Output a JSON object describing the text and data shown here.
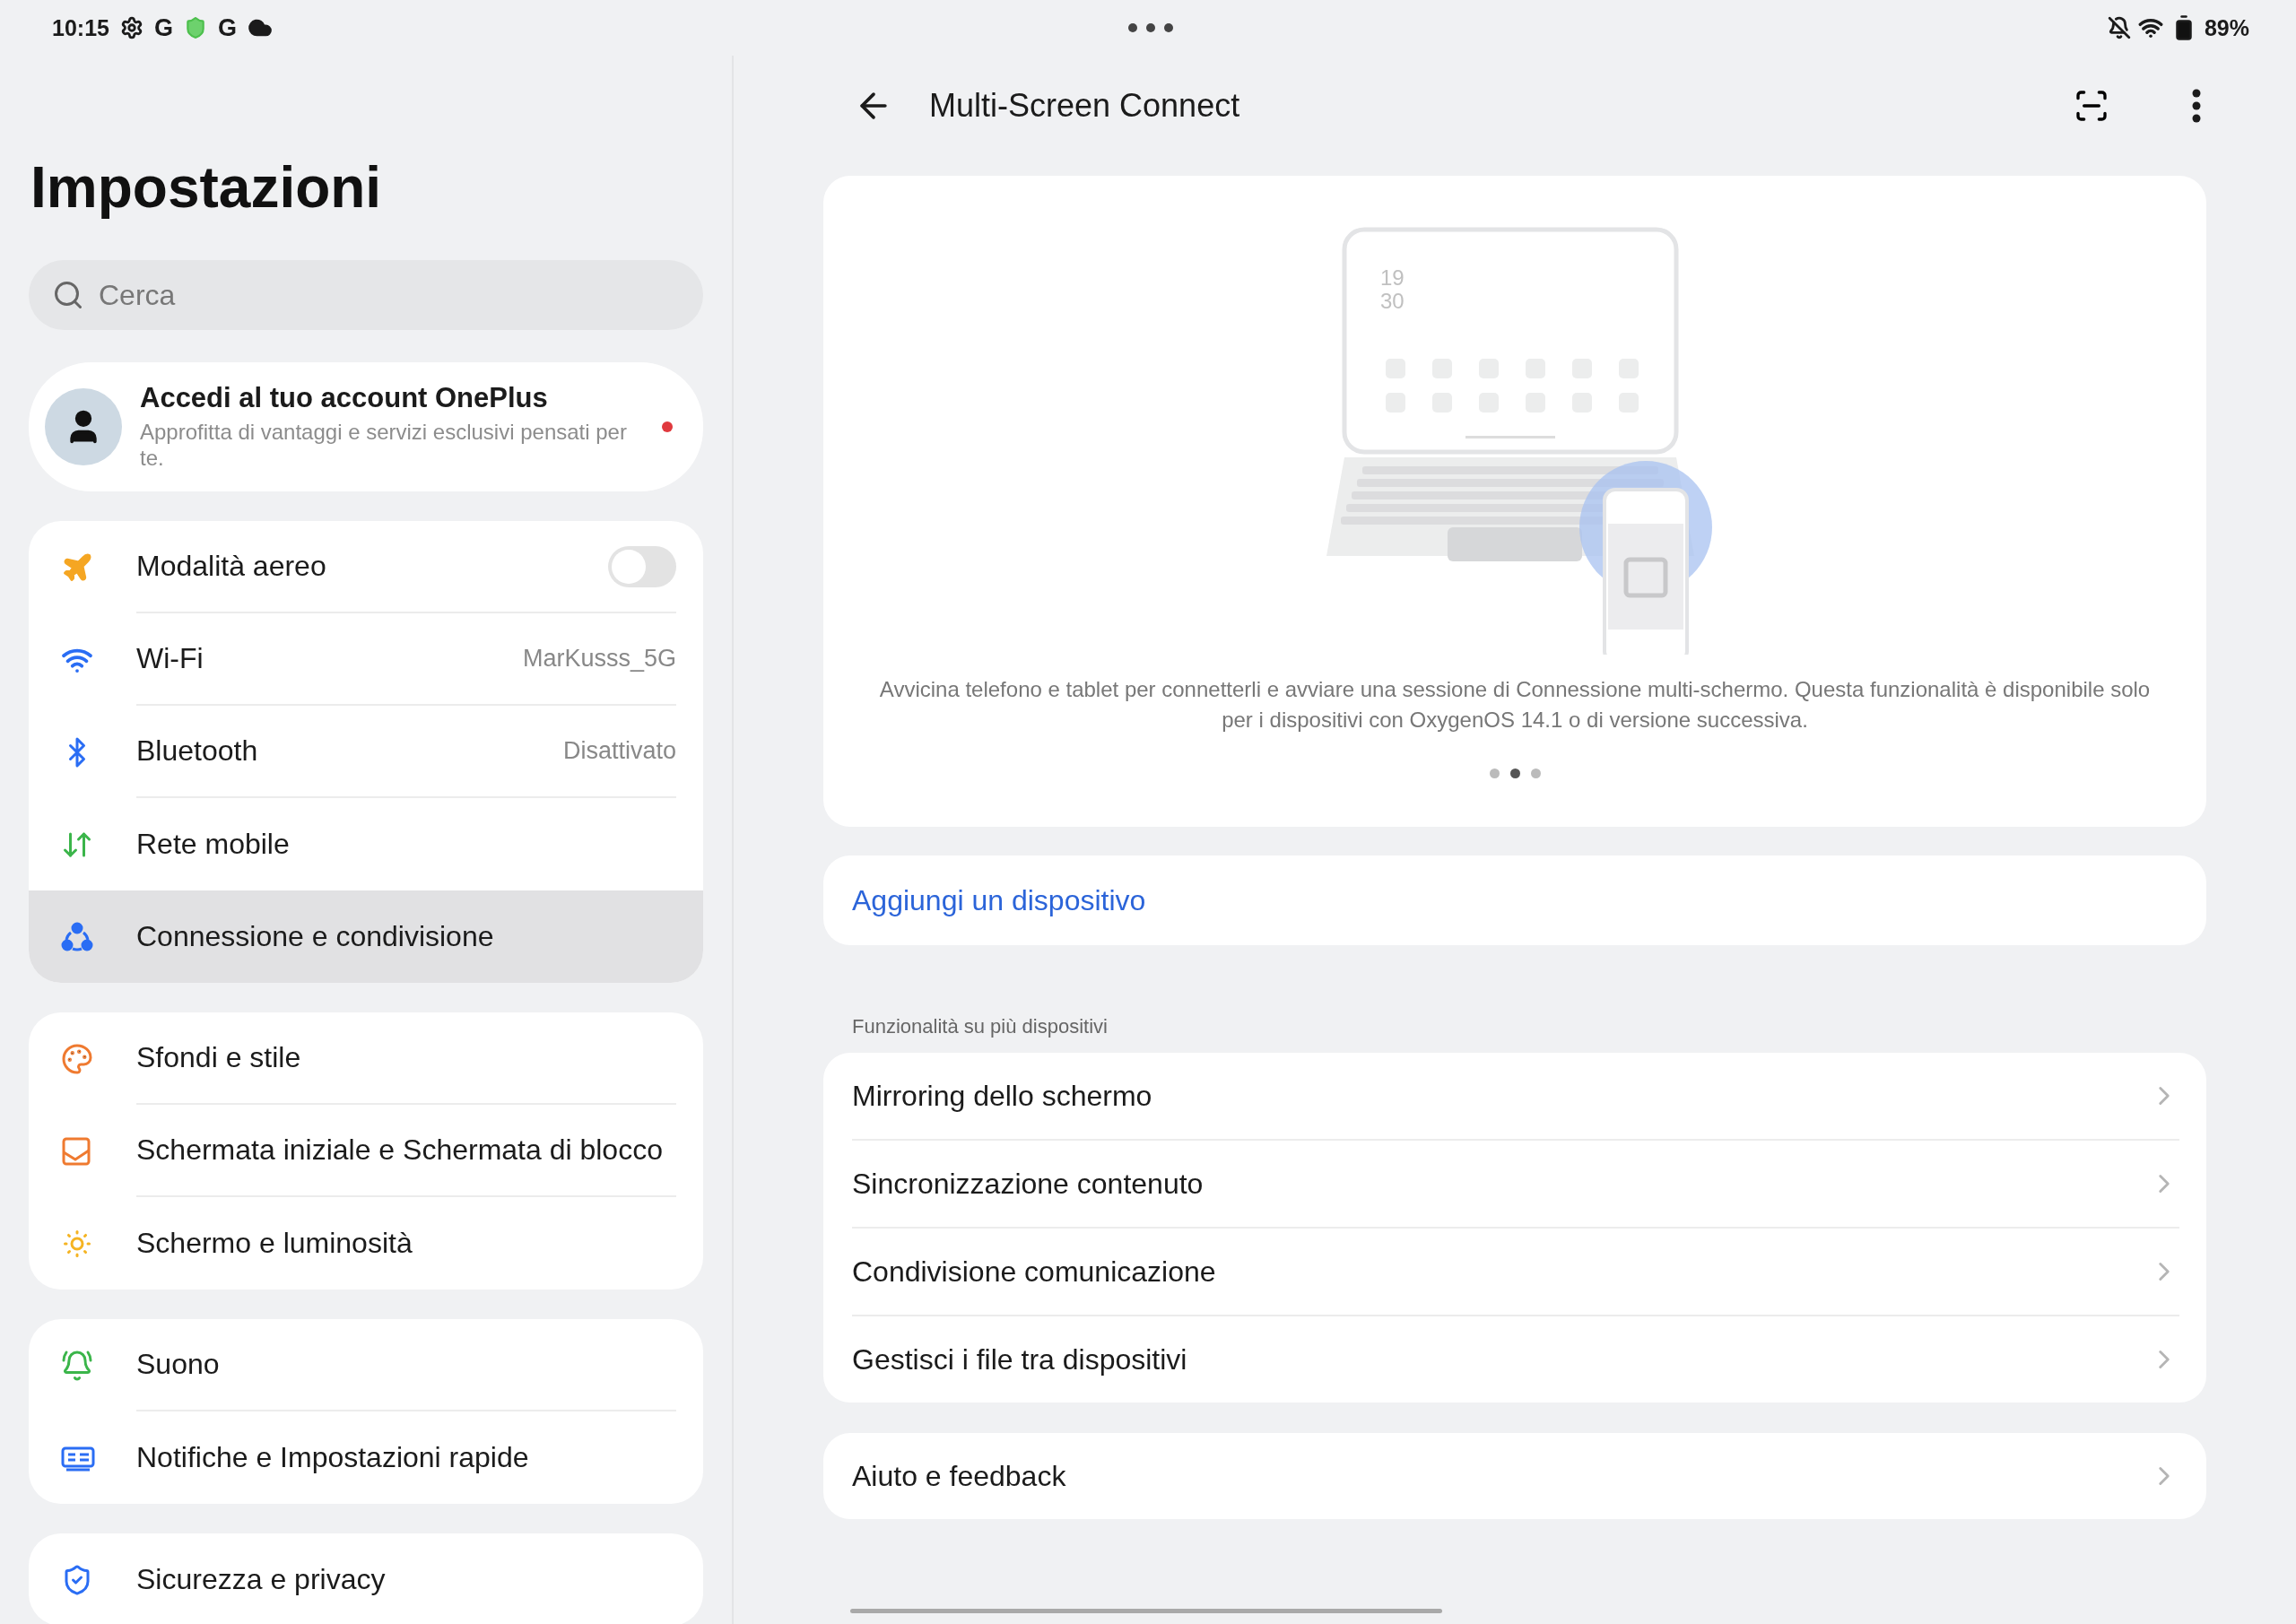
{
  "status_bar": {
    "time": "10:15",
    "notifications": [
      {
        "kind": "gear"
      },
      {
        "kind": "letter",
        "text": "G"
      },
      {
        "kind": "shield"
      },
      {
        "kind": "letter",
        "text": "G"
      },
      {
        "kind": "cloud"
      }
    ],
    "battery": "89%"
  },
  "sidebar": {
    "title": "Impostazioni",
    "search": {
      "placeholder": "Cerca"
    },
    "account": {
      "title": "Accedi al tuo account OnePlus",
      "subtitle": "Approfitta di vantaggi e servizi esclusivi pensati per te.",
      "unread": true
    },
    "groups": [
      [
        {
          "kind": "toggle",
          "label": "Modalità aereo",
          "on": false,
          "selected": false
        },
        {
          "kind": "value",
          "label": "Wi-Fi",
          "value": "MarKusss_5G",
          "selected": false
        },
        {
          "kind": "value",
          "label": "Bluetooth",
          "value": "Disattivato",
          "selected": false
        },
        {
          "kind": "plain",
          "label": "Rete mobile",
          "selected": false
        },
        {
          "kind": "plain",
          "label": "Connessione e condivisione",
          "selected": true
        }
      ],
      [
        {
          "kind": "plain",
          "label": "Sfondi e stile",
          "selected": false
        },
        {
          "kind": "plain",
          "label": "Schermata iniziale e Schermata di blocco",
          "selected": false
        },
        {
          "kind": "plain",
          "label": "Schermo e luminosità",
          "selected": false
        }
      ],
      [
        {
          "kind": "plain",
          "label": "Suono",
          "selected": false
        },
        {
          "kind": "plain",
          "label": "Notifiche e Impostazioni rapide",
          "selected": false
        }
      ],
      [
        {
          "kind": "plain",
          "label": "Sicurezza e privacy",
          "selected": false
        }
      ]
    ]
  },
  "detail": {
    "title": "Multi-Screen Connect",
    "intro": {
      "clock": [
        "19",
        "30"
      ],
      "description": "Avvicina telefono e tablet per connetterli e avviare una sessione di Connessione multi-schermo. Questa funzionalità è disponibile solo per i dispositivi con OxygenOS 14.1 o di versione successiva.",
      "pager": [
        {
          "selected": false
        },
        {
          "selected": true
        },
        {
          "selected": false
        }
      ]
    },
    "add_device": "Aggiungi un dispositivo",
    "section_label": "Funzionalità su più dispositivi",
    "features": [
      "Mirroring dello schermo",
      "Sincronizzazione contenuto",
      "Condivisione comunicazione",
      "Gestisci i file tra dispositivi"
    ],
    "help": "Aiuto e feedback"
  }
}
